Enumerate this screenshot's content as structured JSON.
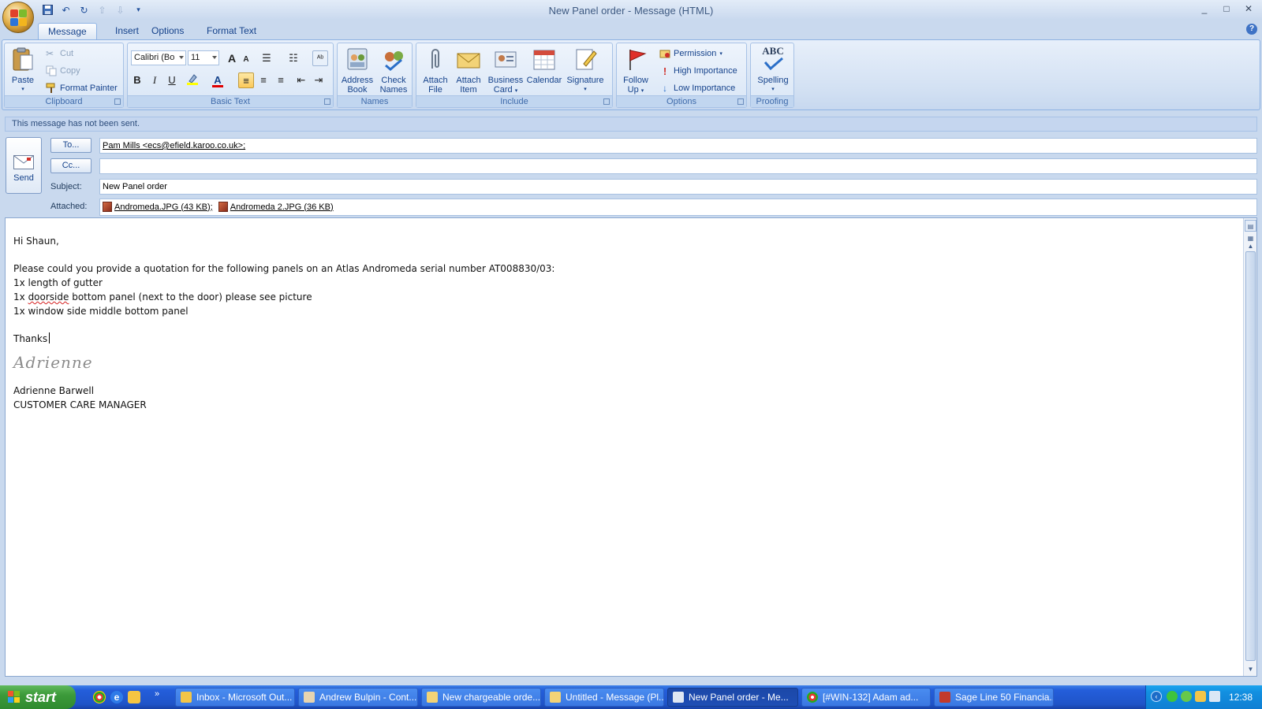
{
  "window": {
    "title": "New Panel order - Message (HTML)",
    "controls": [
      "_",
      "□",
      "✕"
    ]
  },
  "tabs": [
    "Message",
    "Insert",
    "Options",
    "Format Text"
  ],
  "help_icon": "?",
  "ribbon": {
    "clipboard": {
      "label": "Clipboard",
      "paste": "Paste",
      "cut": "Cut",
      "copy": "Copy",
      "format_painter": "Format Painter"
    },
    "basic_text": {
      "label": "Basic Text",
      "font": "Calibri (Bo",
      "size": "11",
      "bold": "B",
      "italic": "I",
      "underline": "U",
      "font_color_glyph": "A",
      "grow_glyph": "A",
      "shrink_glyph": "A"
    },
    "names": {
      "label": "Names",
      "address_book": [
        "Address",
        "Book"
      ],
      "check_names": [
        "Check",
        "Names"
      ]
    },
    "include": {
      "label": "Include",
      "attach_file": [
        "Attach",
        "File"
      ],
      "attach_item": [
        "Attach",
        "Item"
      ],
      "business_card": [
        "Business",
        "Card"
      ],
      "calendar": "Calendar",
      "signature": "Signature"
    },
    "options": {
      "label": "Options",
      "follow_up": [
        "Follow",
        "Up"
      ],
      "permission": "Permission",
      "high_importance": "High Importance",
      "low_importance": "Low Importance"
    },
    "proofing": {
      "label": "Proofing",
      "abc": "ABC",
      "spelling": "Spelling"
    }
  },
  "infobar": "This message has not been sent.",
  "header": {
    "send": "Send",
    "to_button": "To...",
    "cc_button": "Cc...",
    "subject_label": "Subject:",
    "attached_label": "Attached:",
    "to_value": "Pam Mills <ecs@efield.karoo.co.uk>;",
    "cc_value": "",
    "subject_value": "New Panel order",
    "attachments": [
      "Andromeda.JPG (43 KB);",
      "Andromeda 2.JPG (36 KB)"
    ]
  },
  "body": {
    "greeting": "Hi Shaun,",
    "line1": "Please could you provide a quotation for the following panels on an Atlas Andromeda serial number AT008830/03:",
    "item1": "1x length of gutter",
    "item2_prefix": "1x ",
    "item2_misspelled": "doorside",
    "item2_suffix": " bottom panel (next to the door) please see picture",
    "item3": "1x window side middle bottom panel",
    "thanks": "Thanks",
    "signature_script": "Adrienne",
    "sig_name": "Adrienne Barwell",
    "sig_title": "CUSTOMER CARE MANAGER"
  },
  "taskbar": {
    "start": "start",
    "tasks": [
      "Inbox - Microsoft Out...",
      "Andrew Bulpin - Cont...",
      "New chargeable orde...",
      "Untitled - Message (Pl...",
      "New Panel order - Me...",
      "[#WIN-132] Adam ad...",
      "Sage Line 50 Financia..."
    ],
    "active_task_index": 4,
    "clock": "12:38"
  },
  "colors": {
    "ribbon_bg": "#d3e1f3",
    "ribbon_text": "#15428b",
    "taskbar_blue": "#245edb",
    "start_green": "#3c9a3a",
    "misspelling_underline": "#d42020"
  }
}
